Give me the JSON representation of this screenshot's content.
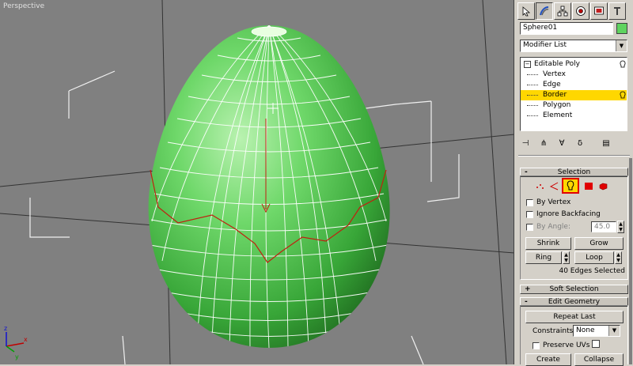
{
  "viewport": {
    "label": "Perspective",
    "axis_x": "x",
    "axis_y": "y",
    "axis_z": "z"
  },
  "command_panel": {
    "tabs": [
      "create-icon",
      "modify-icon",
      "hierarchy-icon",
      "motion-icon",
      "display-icon",
      "utilities-icon"
    ],
    "object_name": "Sphere01",
    "object_color": "#5fd35f",
    "modifier_list_label": "Modifier List",
    "stack": [
      {
        "label": "Editable Poly",
        "selected": false
      },
      {
        "label": "Vertex",
        "selected": false
      },
      {
        "label": "Edge",
        "selected": false
      },
      {
        "label": "Border",
        "selected": true
      },
      {
        "label": "Polygon",
        "selected": false
      },
      {
        "label": "Element",
        "selected": false
      }
    ],
    "stack_toolbar": [
      "pin-stack-icon",
      "show-end-result-icon",
      "make-unique-icon",
      "remove-modifier-icon",
      "configure-sets-icon"
    ]
  },
  "selection": {
    "title": "Selection",
    "by_vertex": "By Vertex",
    "ignore_backfacing": "Ignore Backfacing",
    "by_angle": "By Angle:",
    "angle_value": "45.0",
    "shrink": "Shrink",
    "grow": "Grow",
    "ring": "Ring",
    "loop": "Loop",
    "status": "40 Edges Selected"
  },
  "soft_selection": {
    "title": "Soft Selection"
  },
  "edit_geometry": {
    "title": "Edit Geometry",
    "repeat_last": "Repeat Last",
    "constraints_label": "Constraints:",
    "constraints_value": "None",
    "preserve_uvs": "Preserve UVs",
    "create": "Create",
    "collapse": "Collapse"
  },
  "colors": {
    "viewport_bg": "#808080",
    "mesh": "#4fc04f",
    "selection_highlight": "#ffd700",
    "active_subobject_border": "#ff0000"
  }
}
